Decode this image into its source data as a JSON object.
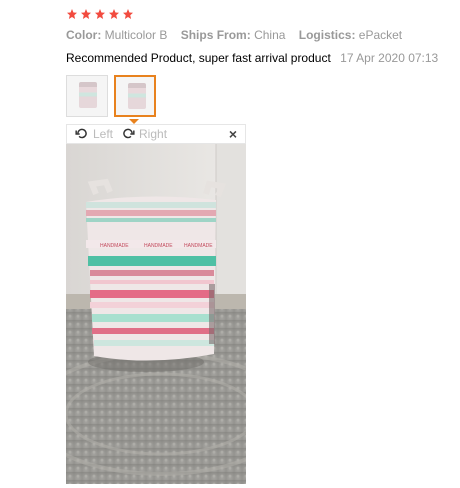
{
  "rating": {
    "stars": 5,
    "color": "#f24b3f"
  },
  "meta": {
    "color_label": "Color:",
    "color_value": "Multicolor B",
    "ships_label": "Ships From:",
    "ships_value": "China",
    "logistics_label": "Logistics:",
    "logistics_value": "ePacket"
  },
  "review": {
    "text": "Recommended Product, super fast arrival product",
    "date": "17 Apr 2020 07:13"
  },
  "thumbnails": [
    {
      "selected": false
    },
    {
      "selected": true
    }
  ],
  "viewer": {
    "left_label": "Left",
    "right_label": "Right",
    "close_symbol": "×"
  },
  "colors": {
    "accent": "#e8821e",
    "muted": "#999999"
  }
}
